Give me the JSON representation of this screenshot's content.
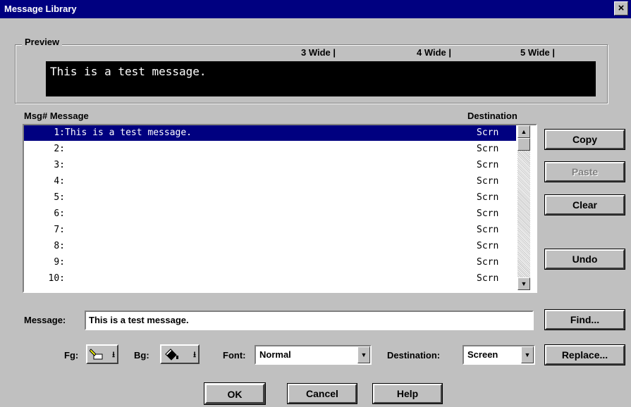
{
  "window": {
    "title": "Message Library",
    "close": "×"
  },
  "preview": {
    "legend": "Preview",
    "wide_markers": [
      "3 Wide |",
      "4 Wide |",
      "5 Wide |"
    ],
    "text": "This is a test message."
  },
  "list": {
    "col_num_msg": "Msg# Message",
    "col_dest": "Destination",
    "rows": [
      {
        "num": "1:",
        "msg": "This is a test message.",
        "dest": "Scrn"
      },
      {
        "num": "2:",
        "msg": "",
        "dest": "Scrn"
      },
      {
        "num": "3:",
        "msg": "",
        "dest": "Scrn"
      },
      {
        "num": "4:",
        "msg": "",
        "dest": "Scrn"
      },
      {
        "num": "5:",
        "msg": "",
        "dest": "Scrn"
      },
      {
        "num": "6:",
        "msg": "",
        "dest": "Scrn"
      },
      {
        "num": "7:",
        "msg": "",
        "dest": "Scrn"
      },
      {
        "num": "8:",
        "msg": "",
        "dest": "Scrn"
      },
      {
        "num": "9:",
        "msg": "",
        "dest": "Scrn"
      },
      {
        "num": "10:",
        "msg": "",
        "dest": "Scrn"
      }
    ],
    "selected_row": 0
  },
  "side_buttons": {
    "copy": "Copy",
    "paste": "Paste",
    "clear": "Clear",
    "undo": "Undo",
    "find": "Find...",
    "replace": "Replace..."
  },
  "message": {
    "label": "Message:",
    "value": "This is a test message."
  },
  "fg": {
    "label": "Fg:",
    "icon": "pen-icon"
  },
  "bg": {
    "label": "Bg:",
    "icon": "paint-bucket-icon"
  },
  "font": {
    "label": "Font:",
    "value": "Normal"
  },
  "destination": {
    "label": "Destination:",
    "value": "Screen"
  },
  "buttons": {
    "ok": "OK",
    "cancel": "Cancel",
    "help": "Help"
  },
  "colors": {
    "titlebar": "#000080",
    "selection": "#000080",
    "face": "#c0c0c0"
  }
}
